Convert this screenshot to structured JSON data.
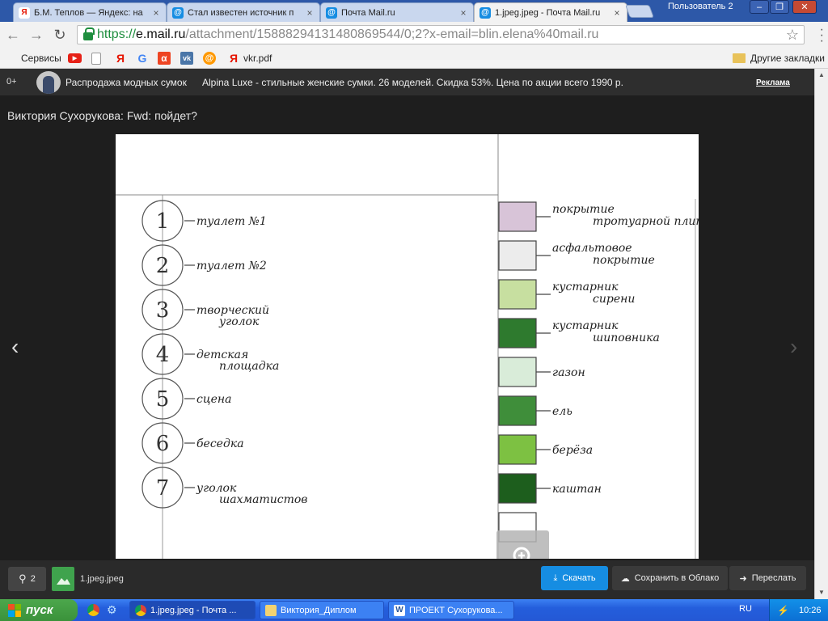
{
  "browser": {
    "tabs": [
      {
        "title": "Б.М. Теплов — Яндекс: на",
        "icon": "yandex-icon",
        "active": false
      },
      {
        "title": "Стал известен источник п",
        "icon": "mailru-icon",
        "active": false
      },
      {
        "title": "Почта Mail.ru",
        "icon": "mailru-icon",
        "active": false
      },
      {
        "title": "1.jpeg.jpeg - Почта Mail.ru",
        "icon": "mailru-icon",
        "active": true
      }
    ],
    "user_label": "Пользователь 2",
    "url": {
      "scheme": "https://",
      "domain": "e.mail.ru",
      "rest": "/attachment/15888294131480869544/0;2?x-email=blin.elena%40mail.ru"
    },
    "bookmarks": [
      "Сервисы",
      "vkr.pdf"
    ],
    "other_bookmarks": "Другие закладки"
  },
  "ad": {
    "age": "0+",
    "title": "Распродажа модных сумок",
    "text": "Alpina Luxe - стильные женские сумки. 26 моделей. Скидка 53%. Цена по акции всего 1990 р.",
    "label": "Реклама"
  },
  "viewer": {
    "subject": "Виктория Сухорукова: Fwd: пойдет?",
    "prev_arrow": "‹",
    "next_arrow": "›",
    "legend_left": [
      {
        "num": "1",
        "label": "туалет №1"
      },
      {
        "num": "2",
        "label": "туалет №2"
      },
      {
        "num": "3",
        "label": "творческий уголок"
      },
      {
        "num": "4",
        "label": "детская площадка"
      },
      {
        "num": "5",
        "label": "сцена"
      },
      {
        "num": "6",
        "label": "беседка"
      },
      {
        "num": "7",
        "label": "уголок шахматистов"
      }
    ],
    "legend_right": [
      {
        "label": "покрытие тротуарной плиткой",
        "swatch": "#d8c4d8"
      },
      {
        "label": "асфальтовое покрытие",
        "swatch": "#ececec"
      },
      {
        "label": "кустарник сирени",
        "swatch": "#c7dfa0"
      },
      {
        "label": "кустарник шиповника",
        "swatch": "#2e7a2e"
      },
      {
        "label": "газон",
        "swatch": "#d9ecd9"
      },
      {
        "label": "ель",
        "swatch": "#3f8e3a"
      },
      {
        "label": "берёза",
        "swatch": "#7dc142"
      },
      {
        "label": "каштан",
        "swatch": "#1d5e1d"
      },
      {
        "label": "",
        "swatch": "#ffffff"
      }
    ]
  },
  "bottom": {
    "attachments_count": "2",
    "filename": "1.jpeg.jpeg",
    "download": "Скачать",
    "save_cloud": "Сохранить в Облако",
    "forward": "Переслать"
  },
  "taskbar": {
    "start": "пуск",
    "tasks": [
      {
        "title": "1.jpeg.jpeg - Почта ...",
        "icon": "chrome-icon",
        "active": true
      },
      {
        "title": "Виктория_Диплом",
        "icon": "folder-icon",
        "active": false
      },
      {
        "title": "ПРОЕКТ Сухорукова...",
        "icon": "word-icon",
        "active": false
      }
    ],
    "lang": "RU",
    "time": "10:26"
  },
  "colors": {
    "download_button": "#168de2",
    "viewer_bg": "#1e1e1e",
    "taskbar": "#245edc",
    "start_button": "#3a923a"
  }
}
